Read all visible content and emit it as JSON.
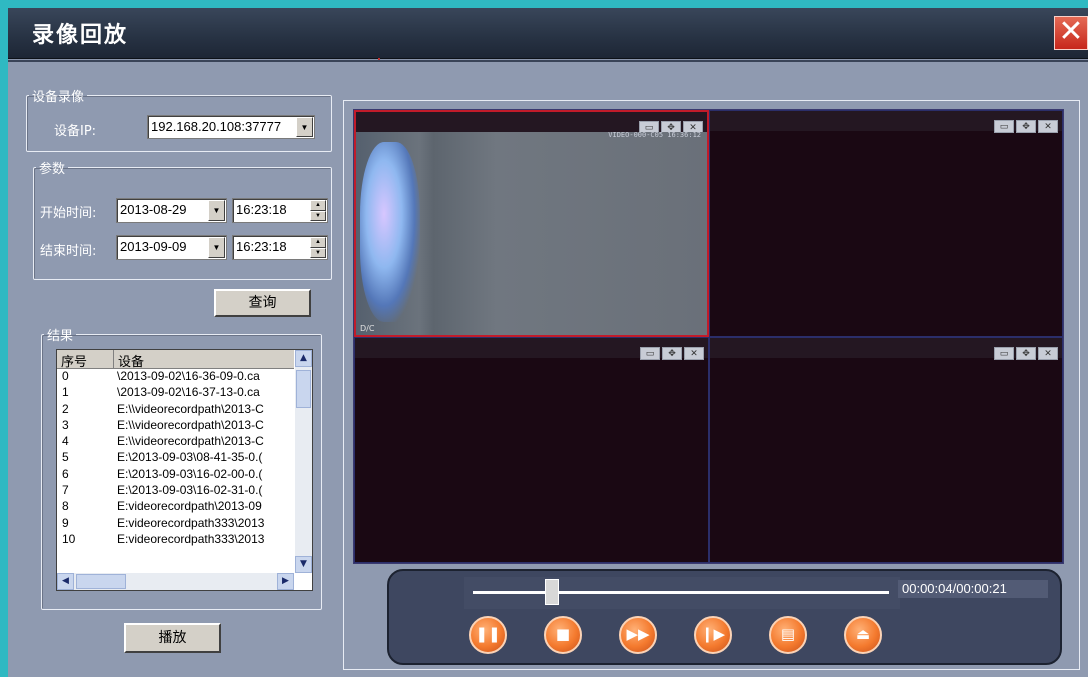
{
  "window": {
    "title": "录像回放",
    "close_symbol": "✕"
  },
  "device_group": {
    "legend": "设备录像",
    "ip_label": "设备IP:",
    "ip_value": "192.168.20.108:37777"
  },
  "params_group": {
    "legend": "参数",
    "start_label": "开始时间:",
    "start_date": "2013-08-29",
    "start_time": "16:23:18",
    "end_label": "结束时间:",
    "end_date": "2013-09-09",
    "end_time": "16:23:18"
  },
  "query_button": "查询",
  "results_group": {
    "legend": "结果",
    "columns": [
      "序号",
      "设备"
    ],
    "rows": [
      [
        "0",
        "\\2013-09-02\\16-36-09-0.ca"
      ],
      [
        "1",
        "\\2013-09-02\\16-37-13-0.ca"
      ],
      [
        "2",
        "E:\\\\videorecordpath\\2013-C"
      ],
      [
        "3",
        "E:\\\\videorecordpath\\2013-C"
      ],
      [
        "4",
        "E:\\\\videorecordpath\\2013-C"
      ],
      [
        "5",
        "E:\\2013-09-03\\08-41-35-0.("
      ],
      [
        "6",
        "E:\\2013-09-03\\16-02-00-0.("
      ],
      [
        "7",
        "E:\\2013-09-03\\16-02-31-0.("
      ],
      [
        "8",
        "E:videorecordpath\\2013-09"
      ],
      [
        "9",
        "E:videorecordpath333\\2013"
      ],
      [
        "10",
        "E:videorecordpath333\\2013"
      ]
    ]
  },
  "play_button": "播放",
  "video": {
    "overlay_text": "VIDEO-000-C05 16:36:12",
    "corner_text": "D/C"
  },
  "player": {
    "time": "00:00:04/00:00:21",
    "progress": 0.19,
    "buttons": [
      "pause-icon",
      "stop-icon",
      "fast-forward-icon",
      "step-forward-icon",
      "snapshot-icon",
      "eject-icon"
    ]
  }
}
